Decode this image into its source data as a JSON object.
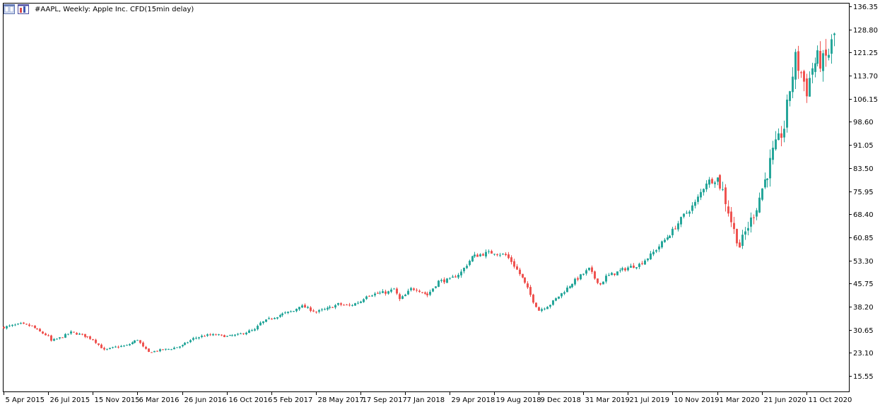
{
  "header": {
    "title": "#AAPL, Weekly:  Apple Inc. CFD(15min delay)",
    "icons": [
      "chart-window-icon",
      "bar-chart-icon"
    ]
  },
  "colors": {
    "bull": "#26a69a",
    "bear": "#ef5350",
    "axis": "#000000",
    "background": "#ffffff"
  },
  "chart_data": {
    "type": "candlestick",
    "title": "#AAPL, Weekly:  Apple Inc. CFD(15min delay)",
    "ylim": [
      10.5,
      137.5
    ],
    "y_ticks": [
      "136.35",
      "128.80",
      "121.25",
      "113.70",
      "106.15",
      "98.60",
      "91.05",
      "83.50",
      "75.95",
      "68.40",
      "60.85",
      "53.30",
      "45.75",
      "38.20",
      "30.65",
      "23.10",
      "15.55"
    ],
    "x_ticks": [
      "5 Apr 2015",
      "26 Jul 2015",
      "15 Nov 2015",
      "6 Mar 2016",
      "26 Jun 2016",
      "16 Oct 2016",
      "5 Feb 2017",
      "28 May 2017",
      "17 Sep 2017",
      "7 Jan 2018",
      "29 Apr 2018",
      "19 Aug 2018",
      "9 Dec 2018",
      "31 Mar 2019",
      "21 Jul 2019",
      "10 Nov 2019",
      "1 Mar 2020",
      "21 Jun 2020",
      "11 Oct 2020"
    ],
    "x_tick_week_index": [
      0,
      16,
      32,
      48,
      64,
      80,
      96,
      112,
      128,
      144,
      160,
      176,
      192,
      208,
      224,
      240,
      256,
      272,
      288
    ],
    "grid": false,
    "series": [
      {
        "weekly_close_anchors": [
          [
            0,
            31.5
          ],
          [
            6,
            32.5
          ],
          [
            10,
            31.8
          ],
          [
            12,
            30.5
          ],
          [
            16,
            28.5
          ],
          [
            17,
            27.0
          ],
          [
            20,
            28.0
          ],
          [
            24,
            29.8
          ],
          [
            28,
            29.0
          ],
          [
            32,
            27.5
          ],
          [
            36,
            24.0
          ],
          [
            40,
            25.0
          ],
          [
            44,
            25.5
          ],
          [
            48,
            27.5
          ],
          [
            50,
            25.0
          ],
          [
            52,
            23.3
          ],
          [
            56,
            24.0
          ],
          [
            60,
            24.5
          ],
          [
            64,
            25.5
          ],
          [
            68,
            27.8
          ],
          [
            72,
            28.8
          ],
          [
            76,
            29.0
          ],
          [
            80,
            28.5
          ],
          [
            84,
            29.0
          ],
          [
            88,
            30.2
          ],
          [
            90,
            30.6
          ],
          [
            92,
            32.8
          ],
          [
            96,
            34.5
          ],
          [
            100,
            35.8
          ],
          [
            104,
            36.8
          ],
          [
            106,
            38.5
          ],
          [
            108,
            38.0
          ],
          [
            112,
            36.5
          ],
          [
            116,
            37.5
          ],
          [
            120,
            39.0
          ],
          [
            124,
            38.5
          ],
          [
            128,
            40.0
          ],
          [
            130,
            42.0
          ],
          [
            134,
            42.5
          ],
          [
            138,
            43.0
          ],
          [
            140,
            44.0
          ],
          [
            142,
            40.5
          ],
          [
            144,
            42.0
          ],
          [
            146,
            44.0
          ],
          [
            148,
            44.0
          ],
          [
            150,
            43.0
          ],
          [
            152,
            42.0
          ],
          [
            156,
            46.5
          ],
          [
            160,
            47.0
          ],
          [
            164,
            49.5
          ],
          [
            168,
            54.5
          ],
          [
            172,
            55.5
          ],
          [
            176,
            56.0
          ],
          [
            180,
            55.0
          ],
          [
            182,
            53.0
          ],
          [
            186,
            47.5
          ],
          [
            188,
            44.0
          ],
          [
            190,
            40.0
          ],
          [
            192,
            37.0
          ],
          [
            196,
            39.0
          ],
          [
            200,
            42.5
          ],
          [
            204,
            46.0
          ],
          [
            208,
            49.0
          ],
          [
            210,
            50.5
          ],
          [
            212,
            47.5
          ],
          [
            214,
            45.5
          ],
          [
            216,
            48.0
          ],
          [
            220,
            49.5
          ],
          [
            224,
            51.0
          ],
          [
            228,
            52.0
          ],
          [
            232,
            55.0
          ],
          [
            236,
            59.0
          ],
          [
            240,
            63.0
          ],
          [
            244,
            68.0
          ],
          [
            248,
            72.0
          ],
          [
            252,
            79.0
          ],
          [
            256,
            80.0
          ],
          [
            258,
            76.0
          ],
          [
            260,
            69.5
          ],
          [
            262,
            63.0
          ],
          [
            264,
            58.0
          ],
          [
            266,
            62.5
          ],
          [
            268,
            66.5
          ],
          [
            270,
            71.0
          ],
          [
            272,
            77.0
          ],
          [
            274,
            82.0
          ],
          [
            276,
            88.5
          ],
          [
            278,
            92.5
          ],
          [
            280,
            97.0
          ],
          [
            282,
            109.5
          ],
          [
            284,
            119.0
          ],
          [
            286,
            114.5
          ],
          [
            288,
            109.0
          ],
          [
            290,
            116.5
          ],
          [
            292,
            119.0
          ],
          [
            294,
            118.0
          ],
          [
            296,
            121.0
          ],
          [
            298,
            127.0
          ]
        ]
      }
    ]
  }
}
